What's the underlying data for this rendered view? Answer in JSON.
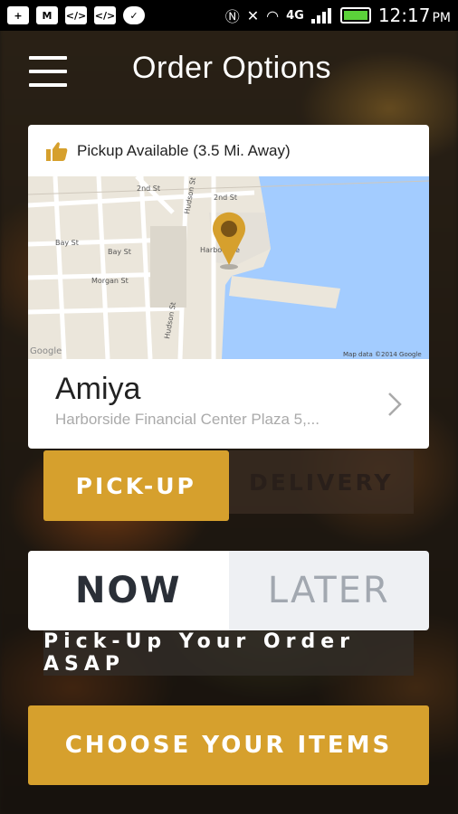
{
  "status_bar": {
    "time": "12:17",
    "ampm": "PM",
    "network": "4G",
    "icons": [
      "add-icon",
      "gmail-icon",
      "code-icon",
      "code-icon",
      "chat-icon",
      "nfc-icon",
      "mute-icon",
      "wifi-icon",
      "signal-icon",
      "battery-icon"
    ]
  },
  "header": {
    "title": "Order Options"
  },
  "location_card": {
    "pickup_status": "Pickup Available (3.5 Mi. Away)",
    "restaurant_name": "Amiya",
    "restaurant_address": "Harborside Financial Center Plaza 5,...",
    "map": {
      "streets": [
        "2nd St",
        "2nd St",
        "Bay St",
        "Bay St",
        "Morgan St",
        "Hudson St",
        "Hudson St",
        "Harborside"
      ],
      "attribution": "Map data ©2014 Google",
      "logo": "Google"
    }
  },
  "mode_toggle": {
    "pickup_label": "PICK-UP",
    "delivery_label": "DELIVERY",
    "selected": "PICK-UP"
  },
  "time_toggle": {
    "now_label": "NOW",
    "later_label": "LATER",
    "selected": "NOW"
  },
  "asap_message": "Pick-Up Your Order ASAP",
  "choose_button_label": "CHOOSE YOUR ITEMS",
  "colors": {
    "accent": "#d6a02d",
    "water": "#a3ccff",
    "land": "#ebe6db"
  }
}
